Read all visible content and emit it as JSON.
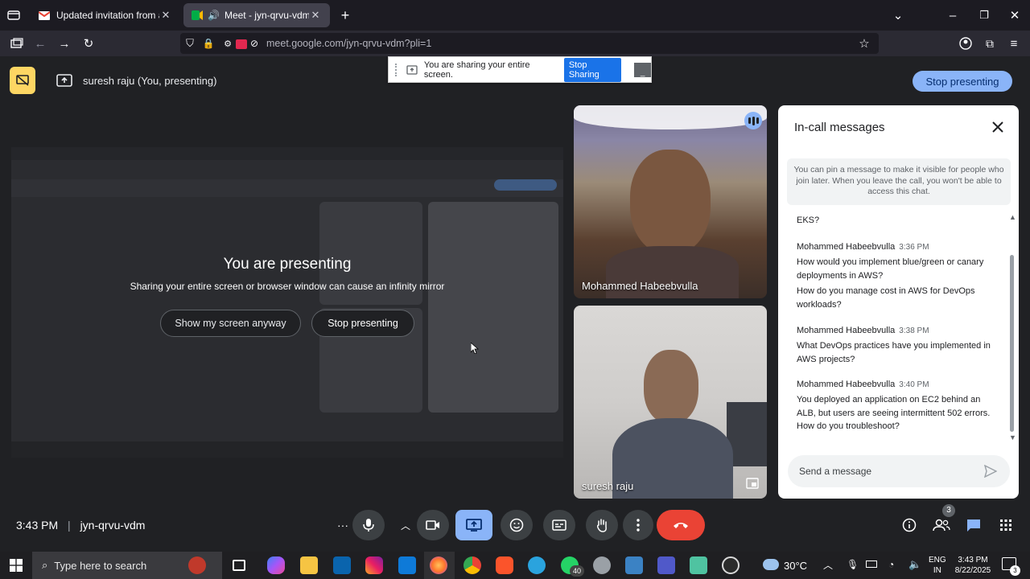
{
  "browser": {
    "tabs": [
      {
        "title": "Updated invitation from an unk",
        "active": false
      },
      {
        "title": "Meet - jyn-qrvu-vdm",
        "active": true
      }
    ],
    "url": "meet.google.com/jyn-qrvu-vdm?pli=1"
  },
  "share_toast": {
    "message": "You are sharing your entire screen.",
    "stop_label": "Stop Sharing"
  },
  "banner": {
    "presenter": "suresh raju (You, presenting)",
    "stop_label": "Stop presenting"
  },
  "presenting": {
    "title": "You are presenting",
    "subtitle": "Sharing your entire screen or browser window can cause an infinity mirror",
    "show_anyway_label": "Show my screen anyway",
    "stop_label": "Stop presenting"
  },
  "participants": [
    {
      "name": "Mohammed Habeebvulla"
    },
    {
      "name": "suresh raju"
    }
  ],
  "chat": {
    "title": "In-call messages",
    "note": "You can pin a message to make it visible for people who join later. When you leave the call, you won't be able to access this chat.",
    "first_line": "EKS?",
    "messages": [
      {
        "sender": "Mohammed Habeebvulla",
        "time": "3:36 PM",
        "lines": [
          "How would you implement blue/green or canary deployments in AWS?",
          "How do you manage cost in AWS for DevOps workloads?"
        ]
      },
      {
        "sender": "Mohammed Habeebvulla",
        "time": "3:38 PM",
        "lines": [
          "What DevOps practices have you implemented in AWS projects?"
        ]
      },
      {
        "sender": "Mohammed Habeebvulla",
        "time": "3:40 PM",
        "lines": [
          "You deployed an application on EC2 behind an ALB, but users are seeing intermittent 502 errors. How do you troubleshoot?"
        ]
      }
    ],
    "input_placeholder": "Send a message"
  },
  "meeting": {
    "time": "3:43 PM",
    "code": "jyn-qrvu-vdm",
    "people_count": "3"
  },
  "taskbar": {
    "search_placeholder": "Type here to search",
    "whatsapp_badge": "40",
    "weather_temp": "30°C",
    "lang": "ENG",
    "region": "IN",
    "clock_time": "3:43 PM",
    "clock_date": "8/22/2025",
    "notification_count": "3"
  },
  "colors": {
    "accent": "#8ab4f8",
    "hangup": "#ea4335",
    "share_active": "#8ab4f8",
    "chat_icon": "#8ab4f8"
  }
}
